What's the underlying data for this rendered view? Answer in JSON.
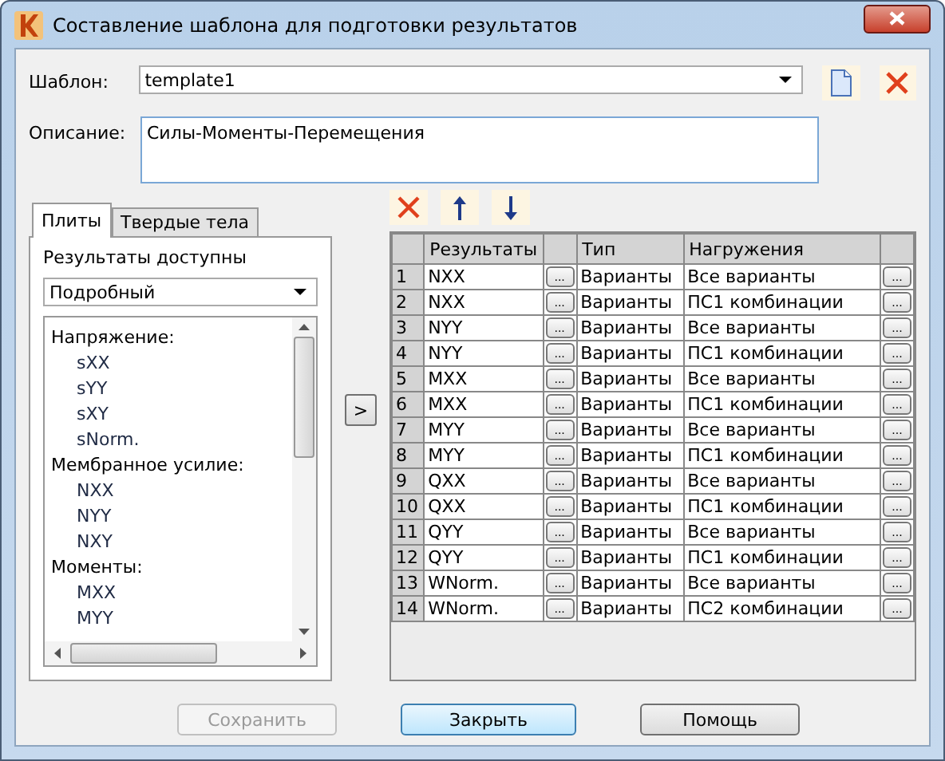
{
  "window": {
    "title": "Составление шаблона для подготовки результатов"
  },
  "template": {
    "label": "Шаблон:",
    "value": "template1"
  },
  "description": {
    "label": "Описание:",
    "value": "Силы-Моменты-Перемещения"
  },
  "tabs": [
    {
      "label": "Плиты",
      "selected": true
    },
    {
      "label": "Твердые тела",
      "selected": false
    }
  ],
  "available": {
    "label": "Результаты доступны",
    "mode": "Подробный"
  },
  "tree": [
    {
      "label": "Напряжение:",
      "children": [
        {
          "label": "sXX"
        },
        {
          "label": "sYY"
        },
        {
          "label": "sXY"
        },
        {
          "label": "sNorm."
        }
      ]
    },
    {
      "label": "Мембранное усилие:",
      "children": [
        {
          "label": "NXX"
        },
        {
          "label": "NYY"
        },
        {
          "label": "NXY"
        }
      ]
    },
    {
      "label": "Моменты:",
      "children": [
        {
          "label": "MXX"
        },
        {
          "label": "MYY"
        }
      ]
    }
  ],
  "add_button": ">",
  "table": {
    "columns": [
      "Результаты",
      "Тип",
      "Нагружения"
    ],
    "rows": [
      {
        "n": "1",
        "result": "NXX",
        "button_1": "...",
        "type": "Варианты",
        "load": "Все варианты",
        "button_2": "..."
      },
      {
        "n": "2",
        "result": "NXX",
        "button_1": "...",
        "type": "Варианты",
        "load": "ПС1 комбинации",
        "button_2": "..."
      },
      {
        "n": "3",
        "result": "NYY",
        "button_1": "...",
        "type": "Варианты",
        "load": "Все варианты",
        "button_2": "..."
      },
      {
        "n": "4",
        "result": "NYY",
        "button_1": "...",
        "type": "Варианты",
        "load": "ПС1 комбинации",
        "button_2": "..."
      },
      {
        "n": "5",
        "result": "MXX",
        "button_1": "...",
        "type": "Варианты",
        "load": "Все варианты",
        "button_2": "..."
      },
      {
        "n": "6",
        "result": "MXX",
        "button_1": "...",
        "type": "Варианты",
        "load": "ПС1 комбинации",
        "button_2": "..."
      },
      {
        "n": "7",
        "result": "MYY",
        "button_1": "...",
        "type": "Варианты",
        "load": "Все варианты",
        "button_2": "..."
      },
      {
        "n": "8",
        "result": "MYY",
        "button_1": "...",
        "type": "Варианты",
        "load": "ПС1 комбинации",
        "button_2": "..."
      },
      {
        "n": "9",
        "result": "QXX",
        "button_1": "...",
        "type": "Варианты",
        "load": "Все варианты",
        "button_2": "..."
      },
      {
        "n": "10",
        "result": "QXX",
        "button_1": "...",
        "type": "Варианты",
        "load": "ПС1 комбинации",
        "button_2": "..."
      },
      {
        "n": "11",
        "result": "QYY",
        "button_1": "...",
        "type": "Варианты",
        "load": "Все варианты",
        "button_2": "..."
      },
      {
        "n": "12",
        "result": "QYY",
        "button_1": "...",
        "type": "Варианты",
        "load": "ПС1 комбинации",
        "button_2": "..."
      },
      {
        "n": "13",
        "result": "WNorm.",
        "button_1": "...",
        "type": "Варианты",
        "load": "Все варианты",
        "button_2": "..."
      },
      {
        "n": "14",
        "result": "WNorm.",
        "button_1": "...",
        "type": "Варианты",
        "load": "ПС2 комбинации",
        "button_2": "..."
      }
    ]
  },
  "buttons": [
    {
      "label": "Сохранить",
      "disabled": true
    },
    {
      "label": "Закрыть",
      "disabled": false
    },
    {
      "label": "Помощь",
      "disabled": false
    }
  ]
}
